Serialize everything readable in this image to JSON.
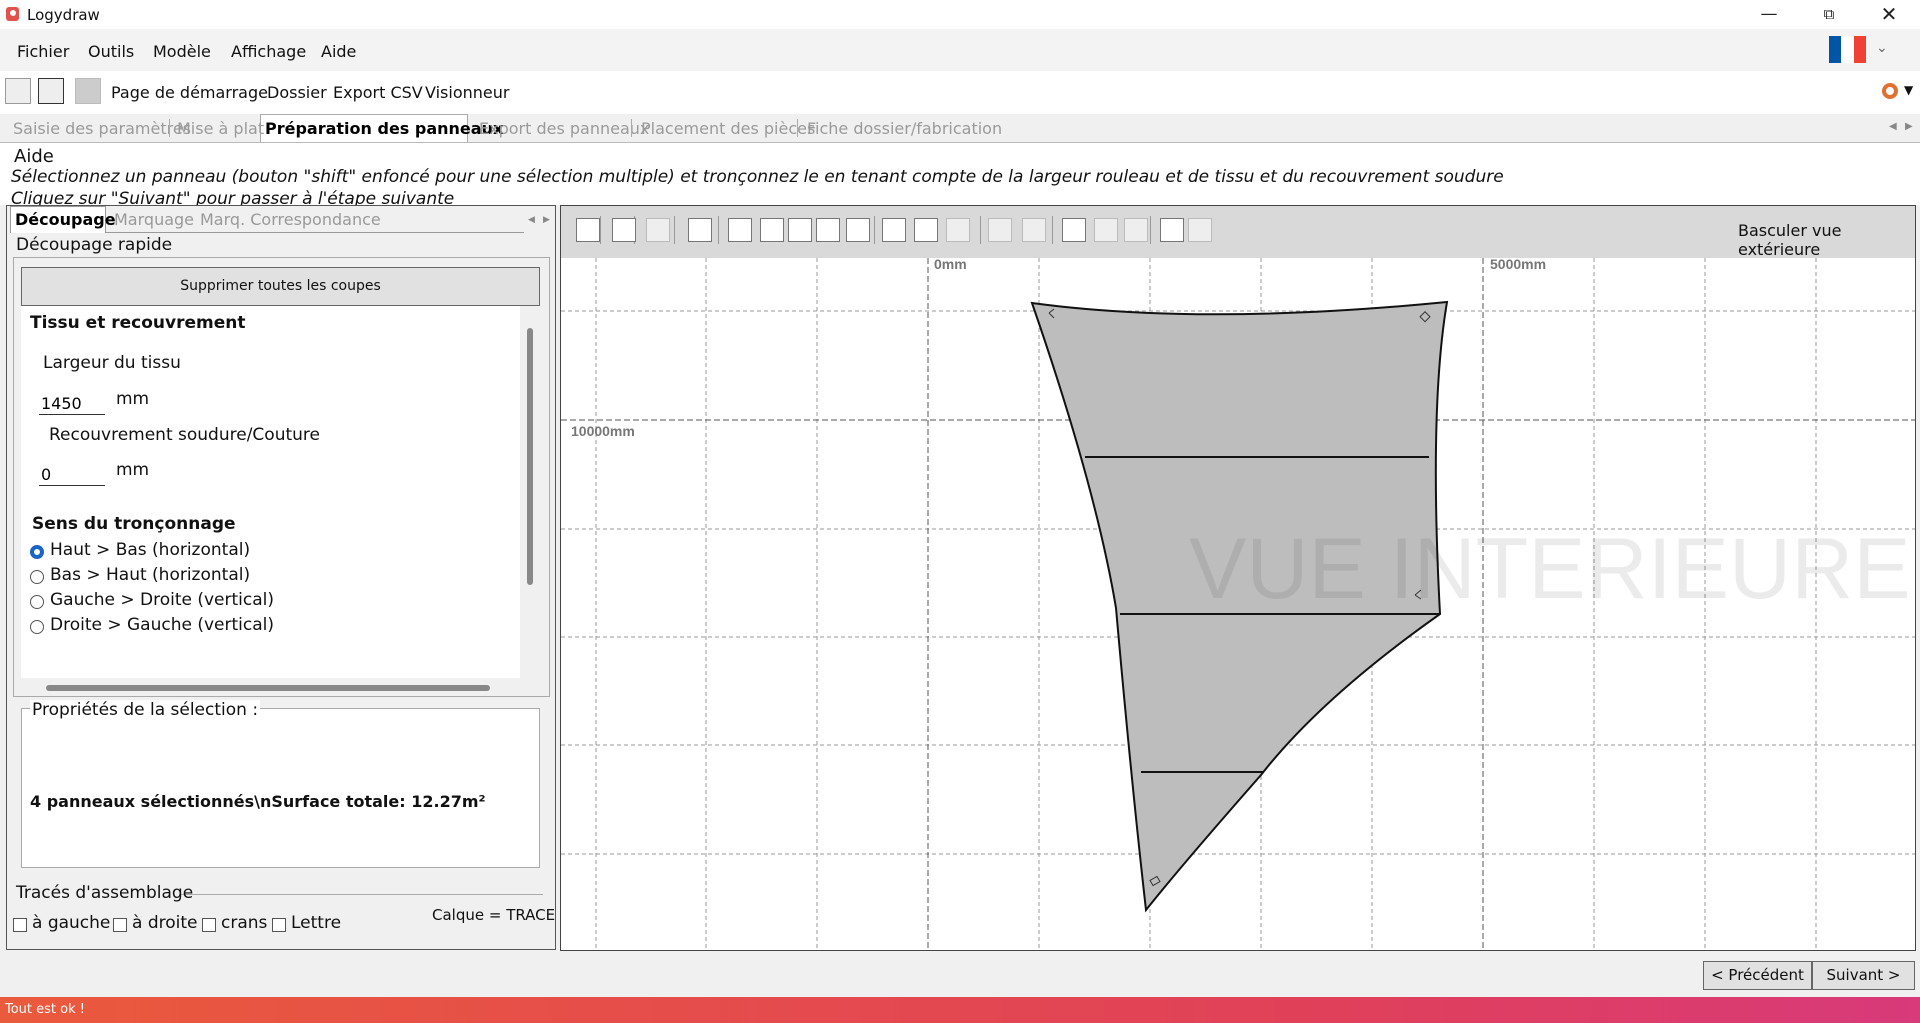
{
  "window": {
    "title": "Logydraw",
    "minimize_icon": "minimize-icon",
    "restore_icon": "restore-icon",
    "close_icon": "close-icon"
  },
  "menu": {
    "items": [
      "Fichier",
      "Outils",
      "Modèle",
      "Affichage",
      "Aide"
    ],
    "flag_colors": [
      "#0055a4",
      "#ffffff",
      "#ef4135"
    ]
  },
  "toolbar": {
    "links": [
      "Page de démarrage",
      "Dossier",
      "Export CSV",
      "Visionneur"
    ]
  },
  "tabs": [
    "Saisie des paramètres",
    "Mise à plat",
    "Préparation des panneaux",
    "Export des panneaux",
    "Placement des pièces",
    "Fiche dossier/fabrication"
  ],
  "active_tab": "Préparation des panneaux",
  "help": {
    "title": "Aide",
    "line1": "Sélectionnez un panneau (bouton \"shift\" enfoncé pour une sélection multiple) et tronçonnez le en tenant compte de la largeur rouleau et de tissu et du recouvrement soudure",
    "line2": "Cliquez sur \"Suivant\" pour passer à l'étape suivante"
  },
  "left_panel": {
    "subtabs": [
      "Découpage",
      "Marquage",
      "Marq. Correspondance"
    ],
    "active_subtab": "Découpage",
    "quick_cut_legend": "Découpage rapide",
    "delete_all_button": "Supprimer toutes les coupes",
    "fabric_section_title": "Tissu et recouvrement",
    "fabric_width_label": "Largeur du tissu",
    "fabric_width_value": "1450",
    "overlap_label": "Recouvrement soudure/Couture",
    "overlap_value": "0",
    "unit": "mm",
    "direction_title": "Sens du tronçonnage",
    "directions": [
      "Haut > Bas (horizontal)",
      "Bas > Haut (horizontal)",
      "Gauche > Droite (vertical)",
      "Droite > Gauche (vertical)"
    ],
    "selected_direction": "Haut > Bas (horizontal)",
    "properties_legend": "Propriétés de la sélection :",
    "properties_value": "4 panneaux sélectionnés\\nSurface totale: 12.27m²",
    "traces_legend": "Tracés d'assemblage",
    "traces_options": [
      "à gauche",
      "à droite",
      "crans",
      "Lettre"
    ],
    "calque_label": "Calque = TRACE"
  },
  "canvas": {
    "switch_view_label": "Basculer vue extérieure",
    "watermark": "VUE INTERIEURE",
    "x_label_0": "0mm",
    "x_label_5000": "5000mm",
    "y_label_10000": "10000mm",
    "panel_fill": "#bdbdbd",
    "tool_icons": [
      "select-icon",
      "undo-icon",
      "redo-icon",
      "eraser-icon",
      "cut-horizontal-icon",
      "cut-shape-icon",
      "curve-left-icon",
      "curve-right-icon",
      "arc-icon",
      "hem-icon",
      "cross-icon",
      "anchor-icon",
      "frame-icon",
      "fill-icon",
      "bar-icon",
      "corner-icon",
      "triangle-icon",
      "weight-icon",
      "layer-icon"
    ]
  },
  "nav": {
    "previous": "< Précédent",
    "next": "Suivant >"
  },
  "status": "Tout est ok !"
}
